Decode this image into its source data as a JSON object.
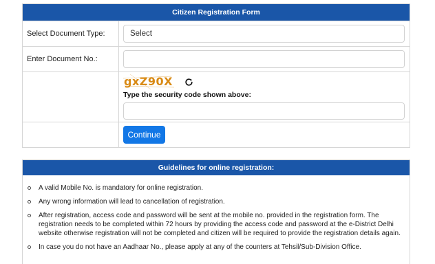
{
  "form": {
    "title": "Citizen Registration Form",
    "document_type_label": "Select Document Type:",
    "document_type_value": "Select",
    "document_no_label": "Enter Document No.:",
    "document_no_value": "",
    "captcha_text": "gxZ90X",
    "security_label": "Type the security code shown above:",
    "security_value": "",
    "continue_label": "Continue",
    "icons": {
      "refresh": "refresh-icon"
    }
  },
  "guidelines": {
    "title": "Guidelines for online registration:",
    "items": [
      "A valid Mobile No. is mandatory for online registration.",
      "Any wrong information will lead to cancellation of registration.",
      "After registration, access code and password will be sent at the mobile no. provided in the registration form. The registration needs to be completed within 72 hours by providing the access code and password at the e-District Delhi website otherwise registration will not be completed and citizen will be required to provide the registration details again.",
      "In case you do not have an Aadhaar No., please apply at any of the counters at Tehsil/Sub-Division Office."
    ]
  },
  "colors": {
    "header_bg": "#1a56a8",
    "button_bg": "#1277e6",
    "captcha": "#d98a14"
  }
}
